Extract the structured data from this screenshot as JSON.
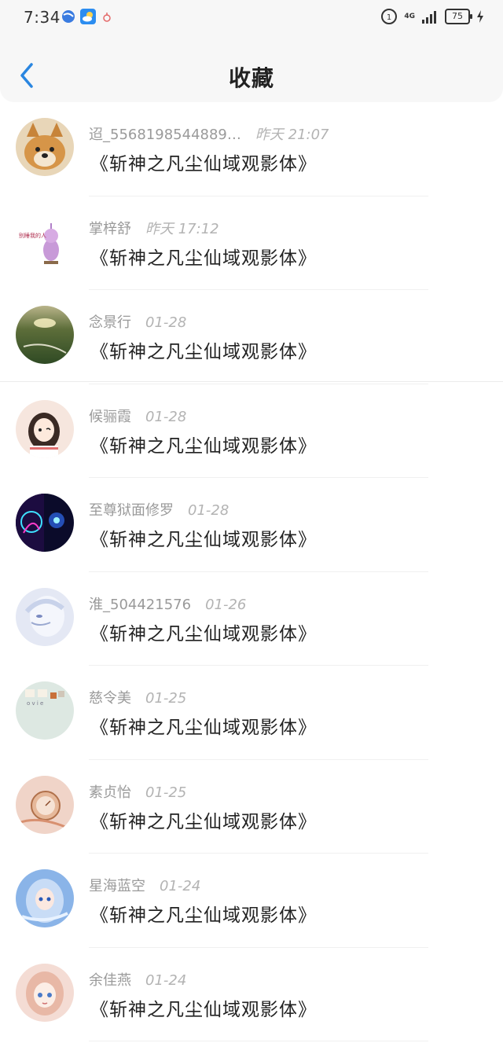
{
  "status_bar": {
    "time": "7:34",
    "network": "4G",
    "battery": "75"
  },
  "header": {
    "title": "收藏",
    "back_icon": "chevron-left-icon",
    "accent_color": "#2a86e0"
  },
  "items": [
    {
      "user": "迢_5568198544889…",
      "time": "昨天 21:07",
      "content": "《斩神之凡尘仙域观影体》"
    },
    {
      "user": "掌梓舒",
      "time": "昨天 17:12",
      "content": "《斩神之凡尘仙域观影体》"
    },
    {
      "user": "念景行",
      "time": "01-28",
      "content": "《斩神之凡尘仙域观影体》"
    },
    {
      "user": "候骊霞",
      "time": "01-28",
      "content": "《斩神之凡尘仙域观影体》"
    },
    {
      "user": "至尊狱面修罗",
      "time": "01-28",
      "content": "《斩神之凡尘仙域观影体》"
    },
    {
      "user": "淮_504421576",
      "time": "01-26",
      "content": "《斩神之凡尘仙域观影体》"
    },
    {
      "user": "慈令美",
      "time": "01-25",
      "content": "《斩神之凡尘仙域观影体》"
    },
    {
      "user": "素贞怡",
      "time": "01-25",
      "content": "《斩神之凡尘仙域观影体》"
    },
    {
      "user": "星海蓝空",
      "time": "01-24",
      "content": "《斩神之凡尘仙域观影体》"
    },
    {
      "user": "余佳燕",
      "time": "01-24",
      "content": "《斩神之凡尘仙域观影体》"
    }
  ]
}
